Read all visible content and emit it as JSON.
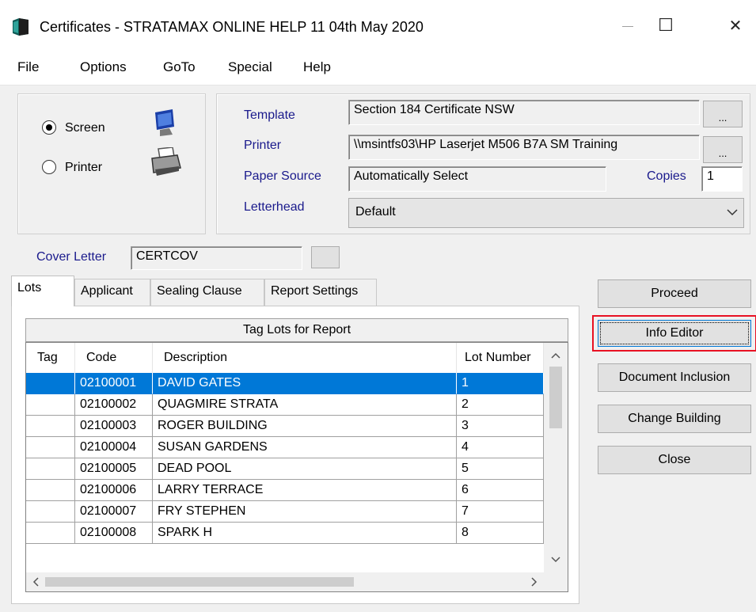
{
  "window": {
    "title": "Certificates - STRATAMAX ONLINE HELP 11 04th May 2020",
    "minimize_glyph": "—",
    "maximize_glyph": "☐",
    "close_glyph": "✕"
  },
  "menu": {
    "items": [
      "File",
      "Options",
      "GoTo",
      "Special",
      "Help"
    ]
  },
  "output": {
    "options": [
      {
        "label": "Screen",
        "checked": true
      },
      {
        "label": "Printer",
        "checked": false
      }
    ]
  },
  "settings": {
    "template_label": "Template",
    "template_value": "Section 184 Certificate NSW",
    "printer_label": "Printer",
    "printer_value": "\\\\msintfs03\\HP Laserjet M506 B7A SM Training",
    "paper_source_label": "Paper Source",
    "paper_source_value": "Automatically Select",
    "copies_label": "Copies",
    "copies_value": "1",
    "letterhead_label": "Letterhead",
    "letterhead_value": "Default",
    "browse_label": "..."
  },
  "cover_letter": {
    "label": "Cover Letter",
    "value": "CERTCOV"
  },
  "tabs": [
    "Lots",
    "Applicant",
    "Sealing Clause",
    "Report Settings"
  ],
  "grid": {
    "title": "Tag Lots for Report",
    "columns": [
      "Tag",
      "Code",
      "Description",
      "Lot Number"
    ],
    "rows": [
      {
        "tag": "",
        "code": "02100001",
        "description": "DAVID GATES",
        "lot": "1",
        "selected": true
      },
      {
        "tag": "",
        "code": "02100002",
        "description": "QUAGMIRE STRATA",
        "lot": "2"
      },
      {
        "tag": "",
        "code": "02100003",
        "description": "ROGER BUILDING",
        "lot": "3"
      },
      {
        "tag": "",
        "code": "02100004",
        "description": "SUSAN GARDENS",
        "lot": "4"
      },
      {
        "tag": "",
        "code": "02100005",
        "description": "DEAD POOL",
        "lot": "5"
      },
      {
        "tag": "",
        "code": "02100006",
        "description": "LARRY TERRACE",
        "lot": "6"
      },
      {
        "tag": "",
        "code": "02100007",
        "description": "FRY STEPHEN",
        "lot": "7"
      },
      {
        "tag": "",
        "code": "02100008",
        "description": "SPARK H",
        "lot": "8"
      }
    ]
  },
  "actions": {
    "proceed": "Proceed",
    "info_editor": "Info Editor",
    "document_inclusion": "Document Inclusion",
    "change_building": "Change Building",
    "close": "Close"
  },
  "colors": {
    "selection": "#0078d7",
    "highlight_outline": "#e81123",
    "label_blue": "#1a1a8c"
  }
}
